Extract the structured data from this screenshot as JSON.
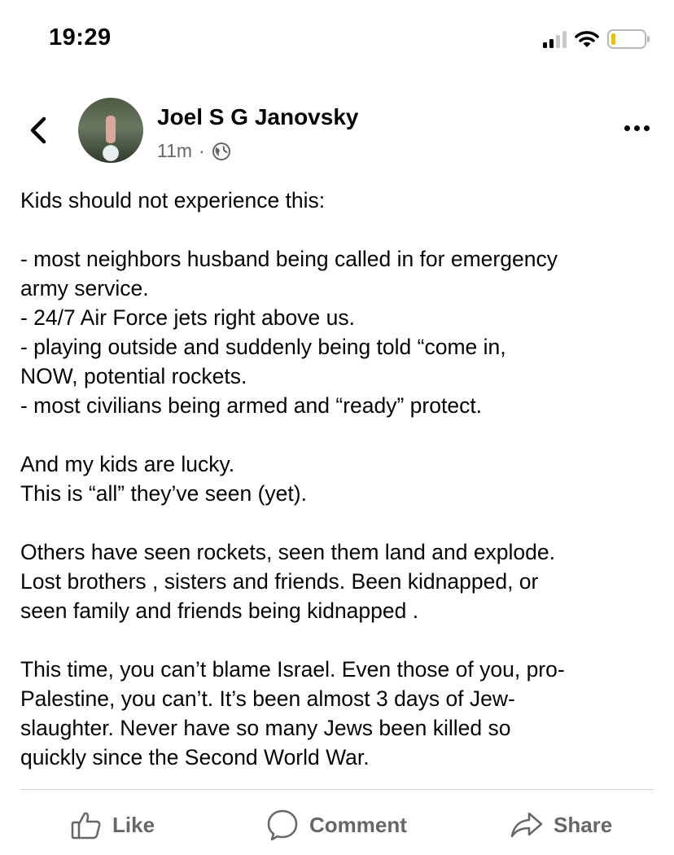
{
  "status_bar": {
    "time": "19:29",
    "icons": [
      "cellular-signal-icon",
      "wifi-icon",
      "battery-icon"
    ]
  },
  "post": {
    "author": "Joel S G Janovsky",
    "time_ago": "11m",
    "separator": "·",
    "audience_icon": "globe-icon",
    "lines": [
      "Kids should not experience this:",
      "",
      "- most neighbors husband being called in for emergency",
      "army service.",
      "- 24/7 Air Force jets right above us.",
      "- playing outside and suddenly being told “come in,",
      "NOW, potential rockets.",
      "- most civilians being armed and “ready” protect.",
      "",
      "And my kids are lucky.",
      "This is “all” they’ve seen (yet).",
      "",
      "Others have seen rockets, seen them land and explode.",
      "Lost brothers , sisters and friends. Been kidnapped, or",
      "seen family and friends being kidnapped .",
      "",
      "This time, you can’t blame Israel. Even those of you, pro-",
      "Palestine, you can’t. It’s been almost 3 days of Jew-",
      "slaughter. Never have so many Jews been killed so",
      "quickly since the Second World War."
    ]
  },
  "actions": {
    "like": "Like",
    "comment": "Comment",
    "share": "Share"
  },
  "colors": {
    "text": "#050505",
    "secondary": "#65676b",
    "divider": "#d0d2d6",
    "battery_level": "#f2c200"
  }
}
